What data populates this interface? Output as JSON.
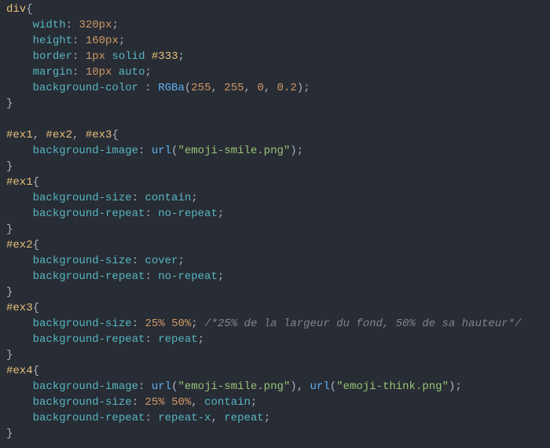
{
  "code": {
    "rules": [
      {
        "selectors": [
          "div"
        ],
        "decls": [
          {
            "prop": "width",
            "value": [
              {
                "t": "num",
                "v": "320px"
              }
            ]
          },
          {
            "prop": "height",
            "value": [
              {
                "t": "num",
                "v": "160px"
              }
            ]
          },
          {
            "prop": "border",
            "value": [
              {
                "t": "num",
                "v": "1px"
              },
              {
                "t": "sp"
              },
              {
                "t": "kw",
                "v": "solid"
              },
              {
                "t": "sp"
              },
              {
                "t": "hex",
                "v": "#333"
              }
            ]
          },
          {
            "prop": "margin",
            "value": [
              {
                "t": "num",
                "v": "10px"
              },
              {
                "t": "sp"
              },
              {
                "t": "kw",
                "v": "auto"
              }
            ]
          },
          {
            "prop": "background-color",
            "space_before_colon": true,
            "value": [
              {
                "t": "fn",
                "v": "RGBa"
              },
              {
                "t": "punc",
                "v": "("
              },
              {
                "t": "num",
                "v": "255"
              },
              {
                "t": "punc",
                "v": ", "
              },
              {
                "t": "num",
                "v": "255"
              },
              {
                "t": "punc",
                "v": ", "
              },
              {
                "t": "num",
                "v": "0"
              },
              {
                "t": "punc",
                "v": ", "
              },
              {
                "t": "num",
                "v": "0.2"
              },
              {
                "t": "punc",
                "v": ")"
              }
            ]
          }
        ]
      },
      {
        "blank": true
      },
      {
        "selectors": [
          "#ex1",
          "#ex2",
          "#ex3"
        ],
        "decls": [
          {
            "prop": "background-image",
            "value": [
              {
                "t": "fn",
                "v": "url"
              },
              {
                "t": "punc",
                "v": "("
              },
              {
                "t": "str",
                "v": "\"emoji-smile.png\""
              },
              {
                "t": "punc",
                "v": ")"
              }
            ]
          }
        ]
      },
      {
        "selectors": [
          "#ex1"
        ],
        "decls": [
          {
            "prop": "background-size",
            "value": [
              {
                "t": "kw",
                "v": "contain"
              }
            ]
          },
          {
            "prop": "background-repeat",
            "value": [
              {
                "t": "kw",
                "v": "no-repeat"
              }
            ]
          }
        ]
      },
      {
        "selectors": [
          "#ex2"
        ],
        "decls": [
          {
            "prop": "background-size",
            "value": [
              {
                "t": "kw",
                "v": "cover"
              }
            ]
          },
          {
            "prop": "background-repeat",
            "value": [
              {
                "t": "kw",
                "v": "no-repeat"
              }
            ]
          }
        ]
      },
      {
        "selectors": [
          "#ex3"
        ],
        "decls": [
          {
            "prop": "background-size",
            "value": [
              {
                "t": "num",
                "v": "25%"
              },
              {
                "t": "sp"
              },
              {
                "t": "num",
                "v": "50%"
              }
            ],
            "comment": "/*25% de la largeur du fond, 50% de sa hauteur*/"
          },
          {
            "prop": "background-repeat",
            "value": [
              {
                "t": "kw",
                "v": "repeat"
              }
            ]
          }
        ]
      },
      {
        "selectors": [
          "#ex4"
        ],
        "decls": [
          {
            "prop": "background-image",
            "value": [
              {
                "t": "fn",
                "v": "url"
              },
              {
                "t": "punc",
                "v": "("
              },
              {
                "t": "str",
                "v": "\"emoji-smile.png\""
              },
              {
                "t": "punc",
                "v": ")"
              },
              {
                "t": "punc",
                "v": ", "
              },
              {
                "t": "fn",
                "v": "url"
              },
              {
                "t": "punc",
                "v": "("
              },
              {
                "t": "str",
                "v": "\"emoji-think.png\""
              },
              {
                "t": "punc",
                "v": ")"
              }
            ]
          },
          {
            "prop": "background-size",
            "value": [
              {
                "t": "num",
                "v": "25%"
              },
              {
                "t": "sp"
              },
              {
                "t": "num",
                "v": "50%"
              },
              {
                "t": "punc",
                "v": ", "
              },
              {
                "t": "kw",
                "v": "contain"
              }
            ]
          },
          {
            "prop": "background-repeat",
            "value": [
              {
                "t": "kw",
                "v": "repeat-x"
              },
              {
                "t": "punc",
                "v": ", "
              },
              {
                "t": "kw",
                "v": "repeat"
              }
            ]
          }
        ]
      }
    ]
  }
}
